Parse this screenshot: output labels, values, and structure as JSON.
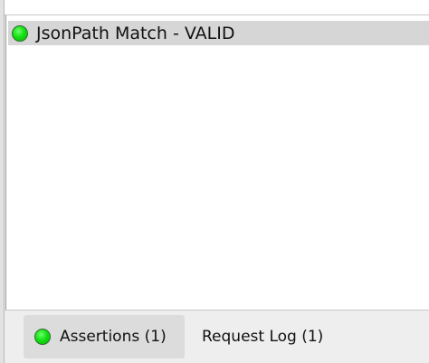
{
  "assertions": {
    "items": [
      {
        "label": "JsonPath Match - VALID",
        "status_icon": "green-status-dot-icon",
        "status_color": "#14e014"
      }
    ]
  },
  "tabs": {
    "assertions_label": "Assertions (1)",
    "assertions_status_icon": "green-status-dot-icon",
    "request_log_label": "Request Log (1)"
  },
  "colors": {
    "status_valid": "#14e014",
    "selected_row": "#d6d6d6",
    "panel_background": "#eeeeee"
  }
}
